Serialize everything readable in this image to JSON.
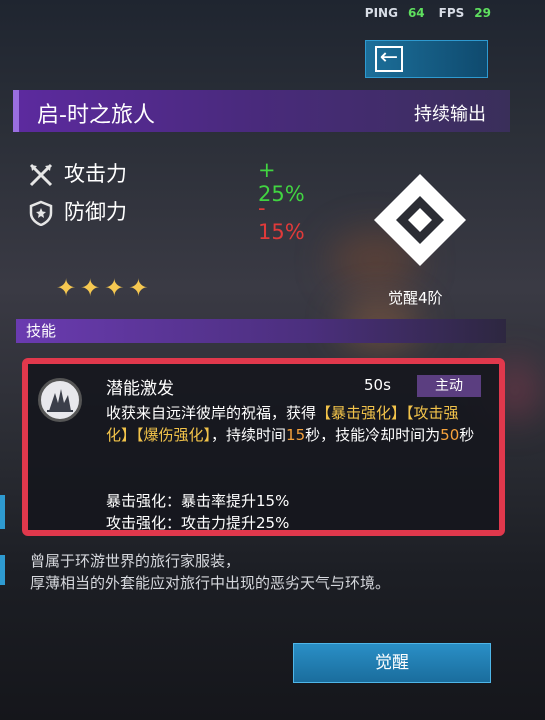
{
  "hud": {
    "ping_label": "PING",
    "ping_value": "64",
    "fps_label": "FPS",
    "fps_value": "29"
  },
  "character": {
    "name": "启-时之旅人",
    "role": "持续输出"
  },
  "stats": [
    {
      "label": "攻击力",
      "value": "+ 25%",
      "color": "#41d441",
      "icon": "sword-icon"
    },
    {
      "label": "防御力",
      "value": "- 15%",
      "color": "#e03a3a",
      "icon": "shield-icon"
    }
  ],
  "stars": {
    "count": 4,
    "glyphs": "✦✦✦✦"
  },
  "awaken": {
    "level_label": "觉醒4阶",
    "button_label": "觉醒"
  },
  "skills": {
    "header": "技能",
    "skill": {
      "name": "潜能激发",
      "cooldown": "50s",
      "type": "主动",
      "desc_parts": [
        "收获来自远洋彼岸的祝福，获得",
        "【暴击强化】",
        "【攻击强化】",
        "【爆伤强化】",
        "，持续时间",
        "15",
        "秒，技能冷却时间为",
        "50",
        "秒"
      ],
      "effect1": "暴击强化：暴击率提升15%",
      "effect2": "攻击强化：攻击力提升25%"
    }
  },
  "flavor": {
    "line1": "曾属于环游世界的旅行家服装，",
    "line2": "厚薄相当的外套能应对旅行中出现的恶劣天气与环境。"
  }
}
